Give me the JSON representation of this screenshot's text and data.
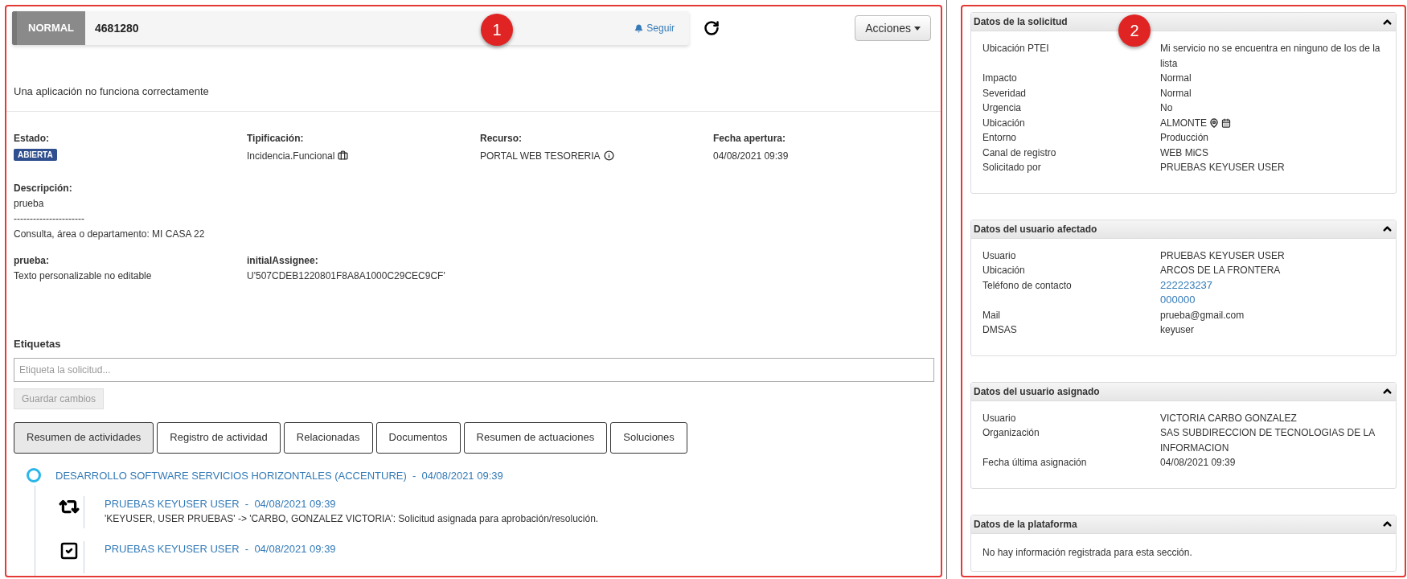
{
  "left_panel": {
    "marker": "1",
    "header": {
      "priority": "NORMAL",
      "number": "4681280",
      "follow": "Seguir",
      "actions": "Acciones"
    },
    "summary": "Una aplicación no funciona correctamente",
    "fields": [
      {
        "label": "Estado:",
        "value": "ABIERTA",
        "kind": "badge"
      },
      {
        "label": "Tipificación:",
        "value": "Incidencia.Funcional",
        "kind": "typed"
      },
      {
        "label": "Recurso:",
        "value": "PORTAL WEB TESORERIA",
        "kind": "info"
      },
      {
        "label": "Fecha apertura:",
        "value": "04/08/2021 09:39",
        "kind": "plain"
      }
    ],
    "description": {
      "label": "Descripción:",
      "lines": [
        "prueba",
        "----------------------",
        "Consulta, área o departamento: MI CASA 22"
      ]
    },
    "custom_fields": [
      {
        "label": "prueba:",
        "value": "Texto personalizable no editable"
      },
      {
        "label": "initialAssignee:",
        "value": "U'507CDEB1220801F8A8A1000C29CEC9CF'"
      }
    ],
    "tags": {
      "label": "Etiquetas",
      "placeholder": "Etiqueta la solicitud...",
      "save": "Guardar cambios"
    },
    "tabs": [
      {
        "label": "Resumen de actividades",
        "selected": true
      },
      {
        "label": "Registro de actividad",
        "selected": false
      },
      {
        "label": "Relacionadas",
        "selected": false
      },
      {
        "label": "Documentos",
        "selected": false
      },
      {
        "label": "Resumen de actuaciones",
        "selected": false
      },
      {
        "label": "Soluciones",
        "selected": false
      }
    ],
    "timeline": {
      "group": "DESARROLLO SOFTWARE SERVICIOS HORIZONTALES (ACCENTURE)  -  04/08/2021 09:39",
      "entries": [
        {
          "kind": "reassign",
          "author": "PRUEBAS KEYUSER USER  -  04/08/2021 09:39",
          "text": "'KEYUSER, USER PRUEBAS' -> 'CARBO, GONZALEZ VICTORIA': Solicitud asignada para aprobación/resolución."
        },
        {
          "kind": "check",
          "author": "PRUEBAS KEYUSER USER  -  04/08/2021 09:39"
        }
      ]
    }
  },
  "right_panel": {
    "marker": "2",
    "sections": [
      {
        "title": "Datos de la solicitud",
        "rows": [
          {
            "label": "Ubicación PTEI",
            "kind": "text",
            "values": [
              "Mi servicio no se encuentra en ninguno de los de la lista"
            ]
          },
          {
            "label": "Impacto",
            "kind": "text",
            "values": [
              "Normal"
            ]
          },
          {
            "label": "Severidad",
            "kind": "text",
            "values": [
              "Normal"
            ]
          },
          {
            "label": "Urgencia",
            "kind": "text",
            "values": [
              "No"
            ]
          },
          {
            "label": "Ubicación",
            "kind": "location",
            "values": [
              "ALMONTE"
            ]
          },
          {
            "label": "Entorno",
            "kind": "text",
            "values": [
              "Producción"
            ]
          },
          {
            "label": "Canal de registro",
            "kind": "text",
            "values": [
              "WEB MiCS"
            ]
          },
          {
            "label": "Solicitado por",
            "kind": "text",
            "values": [
              "PRUEBAS KEYUSER USER"
            ]
          }
        ]
      },
      {
        "title": "Datos del usuario afectado",
        "rows": [
          {
            "label": "Usuario",
            "kind": "text",
            "values": [
              "PRUEBAS KEYUSER USER"
            ]
          },
          {
            "label": "Ubicación",
            "kind": "text",
            "values": [
              "ARCOS DE LA FRONTERA"
            ]
          },
          {
            "label": "Teléfono de contacto",
            "kind": "links",
            "values": [
              "222223237",
              "000000"
            ]
          },
          {
            "label": "Mail",
            "kind": "text",
            "values": [
              "prueba@gmail.com"
            ]
          },
          {
            "label": "DMSAS",
            "kind": "text",
            "values": [
              "keyuser"
            ]
          }
        ]
      },
      {
        "title": "Datos del usuario asignado",
        "rows": [
          {
            "label": "Usuario",
            "kind": "text",
            "values": [
              "VICTORIA CARBO GONZALEZ"
            ]
          },
          {
            "label": "Organización",
            "kind": "text",
            "values": [
              "SAS SUBDIRECCION DE TECNOLOGIAS DE LA INFORMACION"
            ]
          },
          {
            "label": "Fecha última asignación",
            "kind": "text",
            "values": [
              "04/08/2021 09:39"
            ]
          }
        ]
      },
      {
        "title": "Datos de la plataforma",
        "empty": "No hay información registrada para esta sección."
      }
    ]
  }
}
